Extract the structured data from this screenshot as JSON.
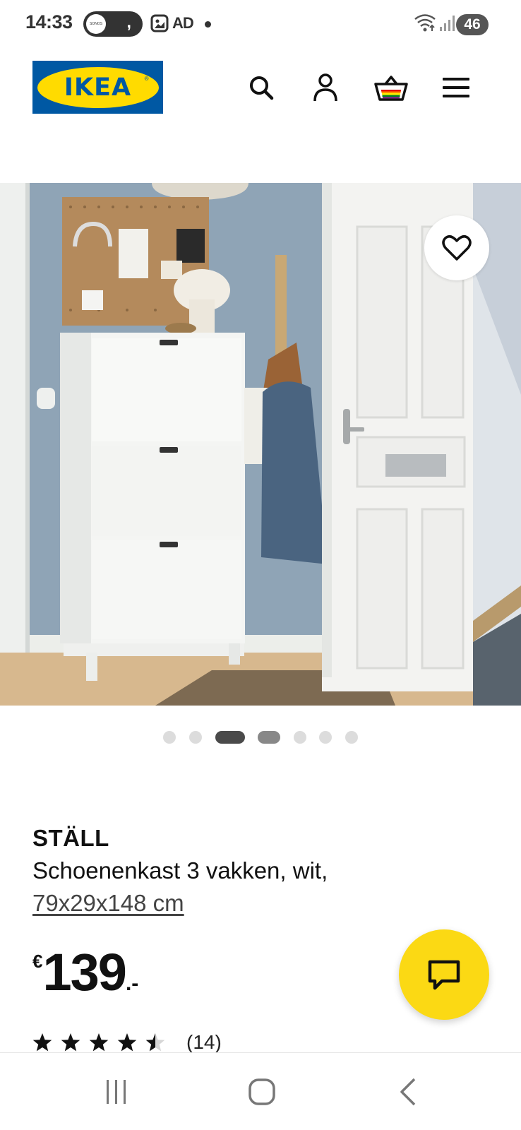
{
  "status_bar": {
    "time": "14:33",
    "sonos_label": "SONOS",
    "ad_label": "AD",
    "battery": "46"
  },
  "header": {
    "logo_text": "IKEA",
    "logo_registered": "®",
    "icons": [
      "search-icon",
      "account-icon",
      "basket-icon",
      "menu-icon"
    ]
  },
  "gallery": {
    "image_count": 7,
    "active_index": 2,
    "favorite_icon": "heart-icon"
  },
  "product": {
    "name": "STÄLL",
    "description": "Schoenenkast 3 vakken, wit,",
    "dimensions": "79x29x148 cm",
    "price_currency": "€",
    "price_value": "139",
    "price_suffix": ".-",
    "rating": 4.5,
    "review_count": "(14)"
  },
  "chat": {
    "icon": "chat-icon"
  },
  "nav_bar": {
    "buttons": [
      "recent-apps-icon",
      "home-icon",
      "back-icon"
    ]
  },
  "colors": {
    "ikea_blue": "#0058a3",
    "ikea_yellow": "#ffdb00",
    "chat_yellow": "#fbd914"
  }
}
